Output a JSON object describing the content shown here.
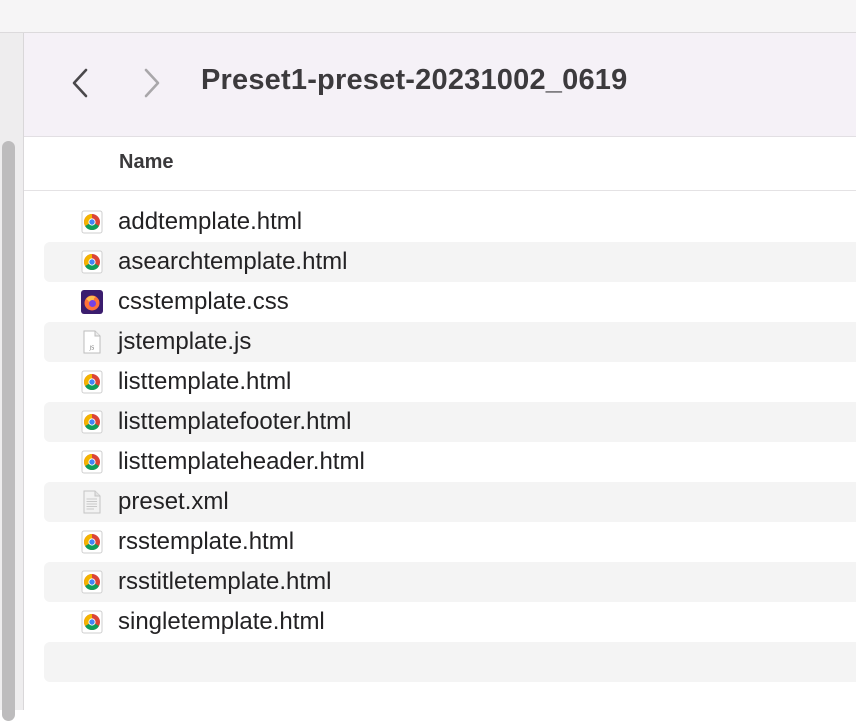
{
  "window": {
    "folder_title": "Preset1-preset-20231002_0619"
  },
  "list_header": {
    "name_column": "Name"
  },
  "files": [
    {
      "name": "addtemplate.html",
      "icon": "chrome-html-icon"
    },
    {
      "name": "asearchtemplate.html",
      "icon": "chrome-html-icon"
    },
    {
      "name": "csstemplate.css",
      "icon": "firefox-css-icon"
    },
    {
      "name": "jstemplate.js",
      "icon": "js-document-icon",
      "icon_text": "JS"
    },
    {
      "name": "listtemplate.html",
      "icon": "chrome-html-icon"
    },
    {
      "name": "listtemplatefooter.html",
      "icon": "chrome-html-icon"
    },
    {
      "name": "listtemplateheader.html",
      "icon": "chrome-html-icon"
    },
    {
      "name": "preset.xml",
      "icon": "xml-document-icon"
    },
    {
      "name": "rsstemplate.html",
      "icon": "chrome-html-icon"
    },
    {
      "name": "rsstitletemplate.html",
      "icon": "chrome-html-icon"
    },
    {
      "name": "singletemplate.html",
      "icon": "chrome-html-icon"
    }
  ],
  "colors": {
    "toolbar_bg": "#f5f1f7",
    "row_alt_bg": "#f4f4f4",
    "text": "#232224"
  }
}
